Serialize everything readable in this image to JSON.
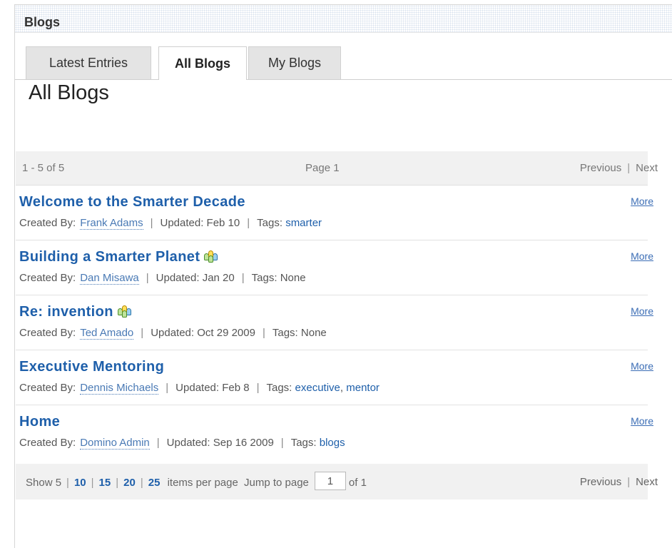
{
  "header": {
    "title": "Blogs"
  },
  "tabs": [
    {
      "label": "Latest Entries",
      "active": false
    },
    {
      "label": "All Blogs",
      "active": true
    },
    {
      "label": "My Blogs",
      "active": false
    }
  ],
  "page_title": "All Blogs",
  "pager_top": {
    "count": "1 - 5 of 5",
    "page": "Page  1",
    "previous": "Previous",
    "separator": "|",
    "next": "Next"
  },
  "entries": [
    {
      "title": "Welcome to the Smarter Decade",
      "community_icon": false,
      "created_label": "Created By:",
      "author": "Frank Adams",
      "updated": "Updated: Feb 10",
      "tags_label": "Tags:",
      "tags": [
        "smarter"
      ],
      "more": "More"
    },
    {
      "title": "Building a Smarter Planet",
      "community_icon": true,
      "created_label": "Created By:",
      "author": "Dan Misawa",
      "updated": "Updated: Jan 20",
      "tags_label": "Tags:",
      "tags_text": "None",
      "more": "More"
    },
    {
      "title": "Re: invention",
      "community_icon": true,
      "created_label": "Created By:",
      "author": "Ted Amado",
      "updated": "Updated: Oct 29 2009",
      "tags_label": "Tags:",
      "tags_text": "None",
      "more": "More"
    },
    {
      "title": "Executive Mentoring",
      "community_icon": false,
      "created_label": "Created By:",
      "author": "Dennis Michaels",
      "updated": "Updated: Feb 8",
      "tags_label": "Tags:",
      "tags": [
        "executive",
        "mentor"
      ],
      "more": "More"
    },
    {
      "title": "Home",
      "community_icon": false,
      "created_label": "Created By:",
      "author": "Domino Admin",
      "updated": "Updated: Sep 16 2009",
      "tags_label": "Tags:",
      "tags": [
        "blogs"
      ],
      "more": "More"
    }
  ],
  "pager_bottom": {
    "show_label": "Show",
    "sizes": [
      "5",
      "10",
      "15",
      "20",
      "25"
    ],
    "items_per_page": "items per page",
    "jump_label": "Jump to page",
    "jump_value": "1",
    "of_pages": "of 1",
    "previous": "Previous",
    "separator": "|",
    "next": "Next"
  }
}
